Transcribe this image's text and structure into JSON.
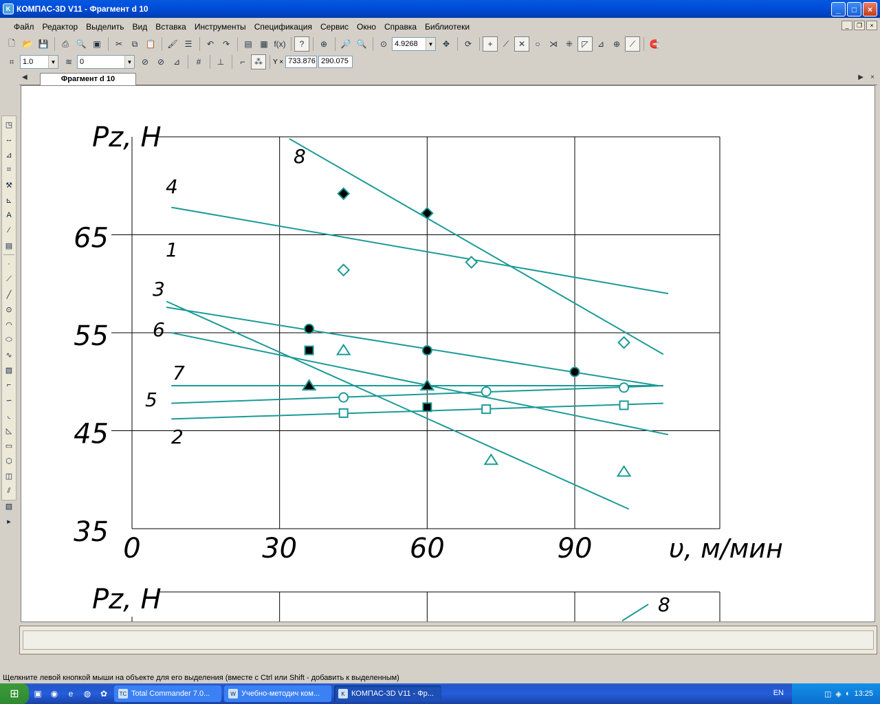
{
  "window": {
    "title": "КОМПАС-3D V11 - Фрагмент d 10",
    "min_label": "_",
    "max_label": "□",
    "close_label": "×"
  },
  "menu": [
    "Файл",
    "Редактор",
    "Выделить",
    "Вид",
    "Вставка",
    "Инструменты",
    "Спецификация",
    "Сервис",
    "Окно",
    "Справка",
    "Библиотеки"
  ],
  "toolbar": {
    "zoom_value": "4.9268",
    "step_value": "1.0",
    "layer_value": "0",
    "coord_x": "733.876",
    "coord_y": "290.075",
    "coord_label": "Y ×"
  },
  "doc_tab": "Фрагмент d 10",
  "status_text": "Щелкните левой кнопкой мыши на объекте для его выделения (вместе с Ctrl или Shift - добавить к выделенным)",
  "taskbar": {
    "tasks": [
      "Total Commander 7.0...",
      "Учебно-методич ком...",
      "КОМПАС-3D V11 - Фр..."
    ],
    "lang": "EN",
    "clock": "13:25"
  },
  "colors": {
    "series": "#1a9a96",
    "grid": "#000000"
  },
  "chart_data": {
    "type": "scatter",
    "title": "",
    "xlabel": "υ, м/мин",
    "ylabel": "Pz, H",
    "x_ticks": [
      "0",
      "30",
      "60",
      "90"
    ],
    "y_ticks": [
      "35",
      "45",
      "55",
      "65"
    ],
    "xlim": [
      0,
      118
    ],
    "ylim": [
      35,
      75
    ],
    "series": [
      {
        "name": "8",
        "line": [
          [
            32,
            74.8
          ],
          [
            108,
            52.8
          ]
        ],
        "marker": "diamond-filled",
        "points": [
          [
            43,
            69.2
          ],
          [
            60,
            67.2
          ]
        ]
      },
      {
        "name": "4",
        "line": [
          [
            8,
            67.8
          ],
          [
            109,
            59.0
          ]
        ],
        "marker": "diamond-open",
        "points": [
          [
            43,
            61.4
          ],
          [
            69,
            62.2
          ],
          [
            100,
            54.0
          ]
        ]
      },
      {
        "name": "1",
        "line": [
          [
            7,
            58.2
          ],
          [
            101,
            37.0
          ]
        ],
        "marker": "square-filled",
        "points": [
          [
            36,
            53.2
          ],
          [
            60,
            47.4
          ]
        ]
      },
      {
        "name": "3",
        "line": [
          [
            7,
            57.6
          ],
          [
            107,
            49.6
          ]
        ],
        "marker": "circle-filled",
        "points": [
          [
            36,
            55.4
          ],
          [
            60,
            53.2
          ],
          [
            90,
            51.0
          ]
        ]
      },
      {
        "name": "6",
        "line": [
          [
            8,
            55.0
          ],
          [
            109,
            44.6
          ]
        ],
        "marker": "triangle-open",
        "points": [
          [
            43,
            53.2
          ],
          [
            73,
            42.0
          ],
          [
            100,
            40.8
          ]
        ]
      },
      {
        "name": "7",
        "line": [
          [
            8,
            49.6
          ],
          [
            108,
            49.6
          ]
        ],
        "marker": "triangle-filled",
        "points": [
          [
            36,
            49.6
          ],
          [
            60,
            49.6
          ]
        ]
      },
      {
        "name": "5",
        "line": [
          [
            8,
            47.8
          ],
          [
            108,
            49.6
          ]
        ],
        "marker": "circle-open",
        "points": [
          [
            43,
            48.4
          ],
          [
            72,
            49.0
          ],
          [
            100,
            49.4
          ]
        ]
      },
      {
        "name": "2",
        "line": [
          [
            8,
            46.2
          ],
          [
            108,
            47.8
          ]
        ],
        "marker": "square-open",
        "points": [
          [
            43,
            46.8
          ],
          [
            72,
            47.2
          ],
          [
            100,
            47.6
          ]
        ]
      }
    ],
    "lower_chart": {
      "ylabel": "Pz, H",
      "series_label": "8"
    }
  }
}
